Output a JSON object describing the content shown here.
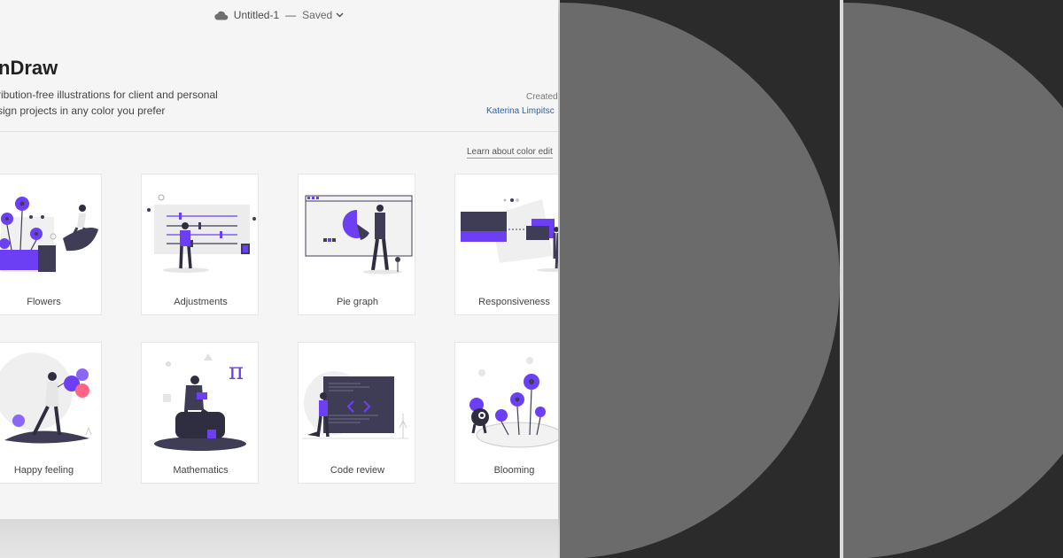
{
  "window": {
    "doc_name": "Untitled-1",
    "separator": "—",
    "status": "Saved",
    "icons": [
      "cloud-icon",
      "chevron-down-icon"
    ]
  },
  "header": {
    "title": "nDraw",
    "description_line1": "ribution-free illustrations for client and personal",
    "description_line2": "sign projects in any color you prefer",
    "created_label": "Created",
    "author": "Katerina Limpitsc"
  },
  "link": {
    "learn_color": "Learn about color edit"
  },
  "gallery": {
    "items": [
      {
        "label": "Flowers"
      },
      {
        "label": "Adjustments"
      },
      {
        "label": "Pie graph"
      },
      {
        "label": "Responsiveness"
      },
      {
        "label": "Happy feeling"
      },
      {
        "label": "Mathematics"
      },
      {
        "label": "Code review"
      },
      {
        "label": "Blooming"
      }
    ]
  },
  "math_symbol": "π",
  "colors": {
    "accent": "#6c3ef4",
    "dark": "#3f3d56",
    "panel_bg": "#2b2b2b",
    "panel_circle": "#6b6b6b"
  }
}
